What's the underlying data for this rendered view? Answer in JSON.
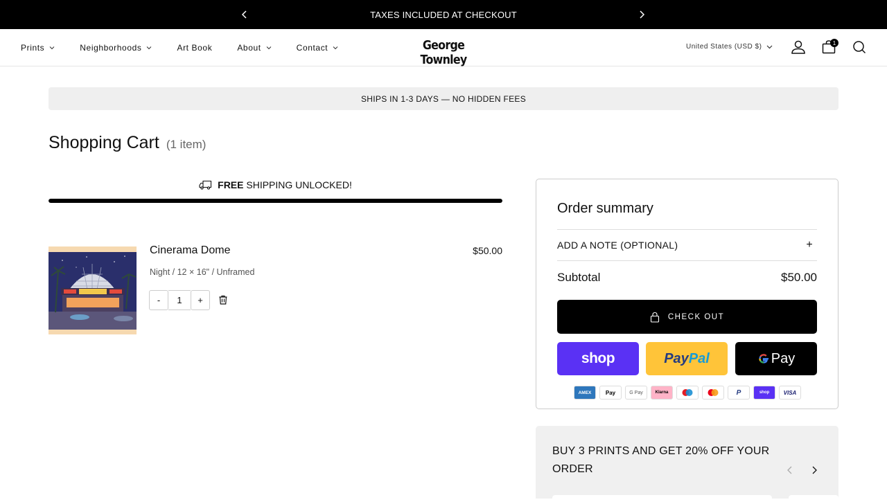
{
  "announcement": {
    "text": "TAXES INCLUDED AT CHECKOUT"
  },
  "nav": {
    "items": [
      {
        "label": "Prints",
        "has_dropdown": true
      },
      {
        "label": "Neighborhoods",
        "has_dropdown": true
      },
      {
        "label": "Art Book",
        "has_dropdown": false
      },
      {
        "label": "About",
        "has_dropdown": true
      },
      {
        "label": "Contact",
        "has_dropdown": true
      }
    ]
  },
  "logo": {
    "text": "George Townley"
  },
  "header": {
    "country": "United States (USD $)",
    "cart_count": "1"
  },
  "banner": {
    "text": "SHIPS IN 1-3 DAYS — NO HIDDEN FEES"
  },
  "page": {
    "title": "Shopping Cart",
    "item_count": "(1 item)"
  },
  "free_shipping": {
    "bold": "FREE",
    "rest": "SHIPPING UNLOCKED!",
    "progress": 1.0
  },
  "cart_item": {
    "title": "Cinerama Dome",
    "variant": "Night / 12 × 16\" / Unframed",
    "price": "$50.00",
    "quantity": "1",
    "minus": "-",
    "plus": "+"
  },
  "summary": {
    "title": "Order summary",
    "note_label": "ADD A NOTE (OPTIONAL)",
    "note_icon": "+",
    "subtotal_label": "Subtotal",
    "subtotal_value": "$50.00",
    "checkout_label": "CHECK OUT",
    "pay_shop": "shop",
    "pay_paypal_1": "Pay",
    "pay_paypal_2": "Pal",
    "pay_gpay": "Pay",
    "payment_icons": [
      "amex",
      "apple-pay",
      "google-pay",
      "klarna",
      "maestro",
      "mastercard",
      "paypal",
      "shop-pay",
      "visa"
    ]
  },
  "promo": {
    "text": "BUY 3 PRINTS AND GET 20% OFF YOUR ORDER"
  },
  "colors": {
    "shop": "#5a31f4",
    "paypal": "#ffc439",
    "black": "#000000",
    "banner_bg": "#efefef"
  }
}
